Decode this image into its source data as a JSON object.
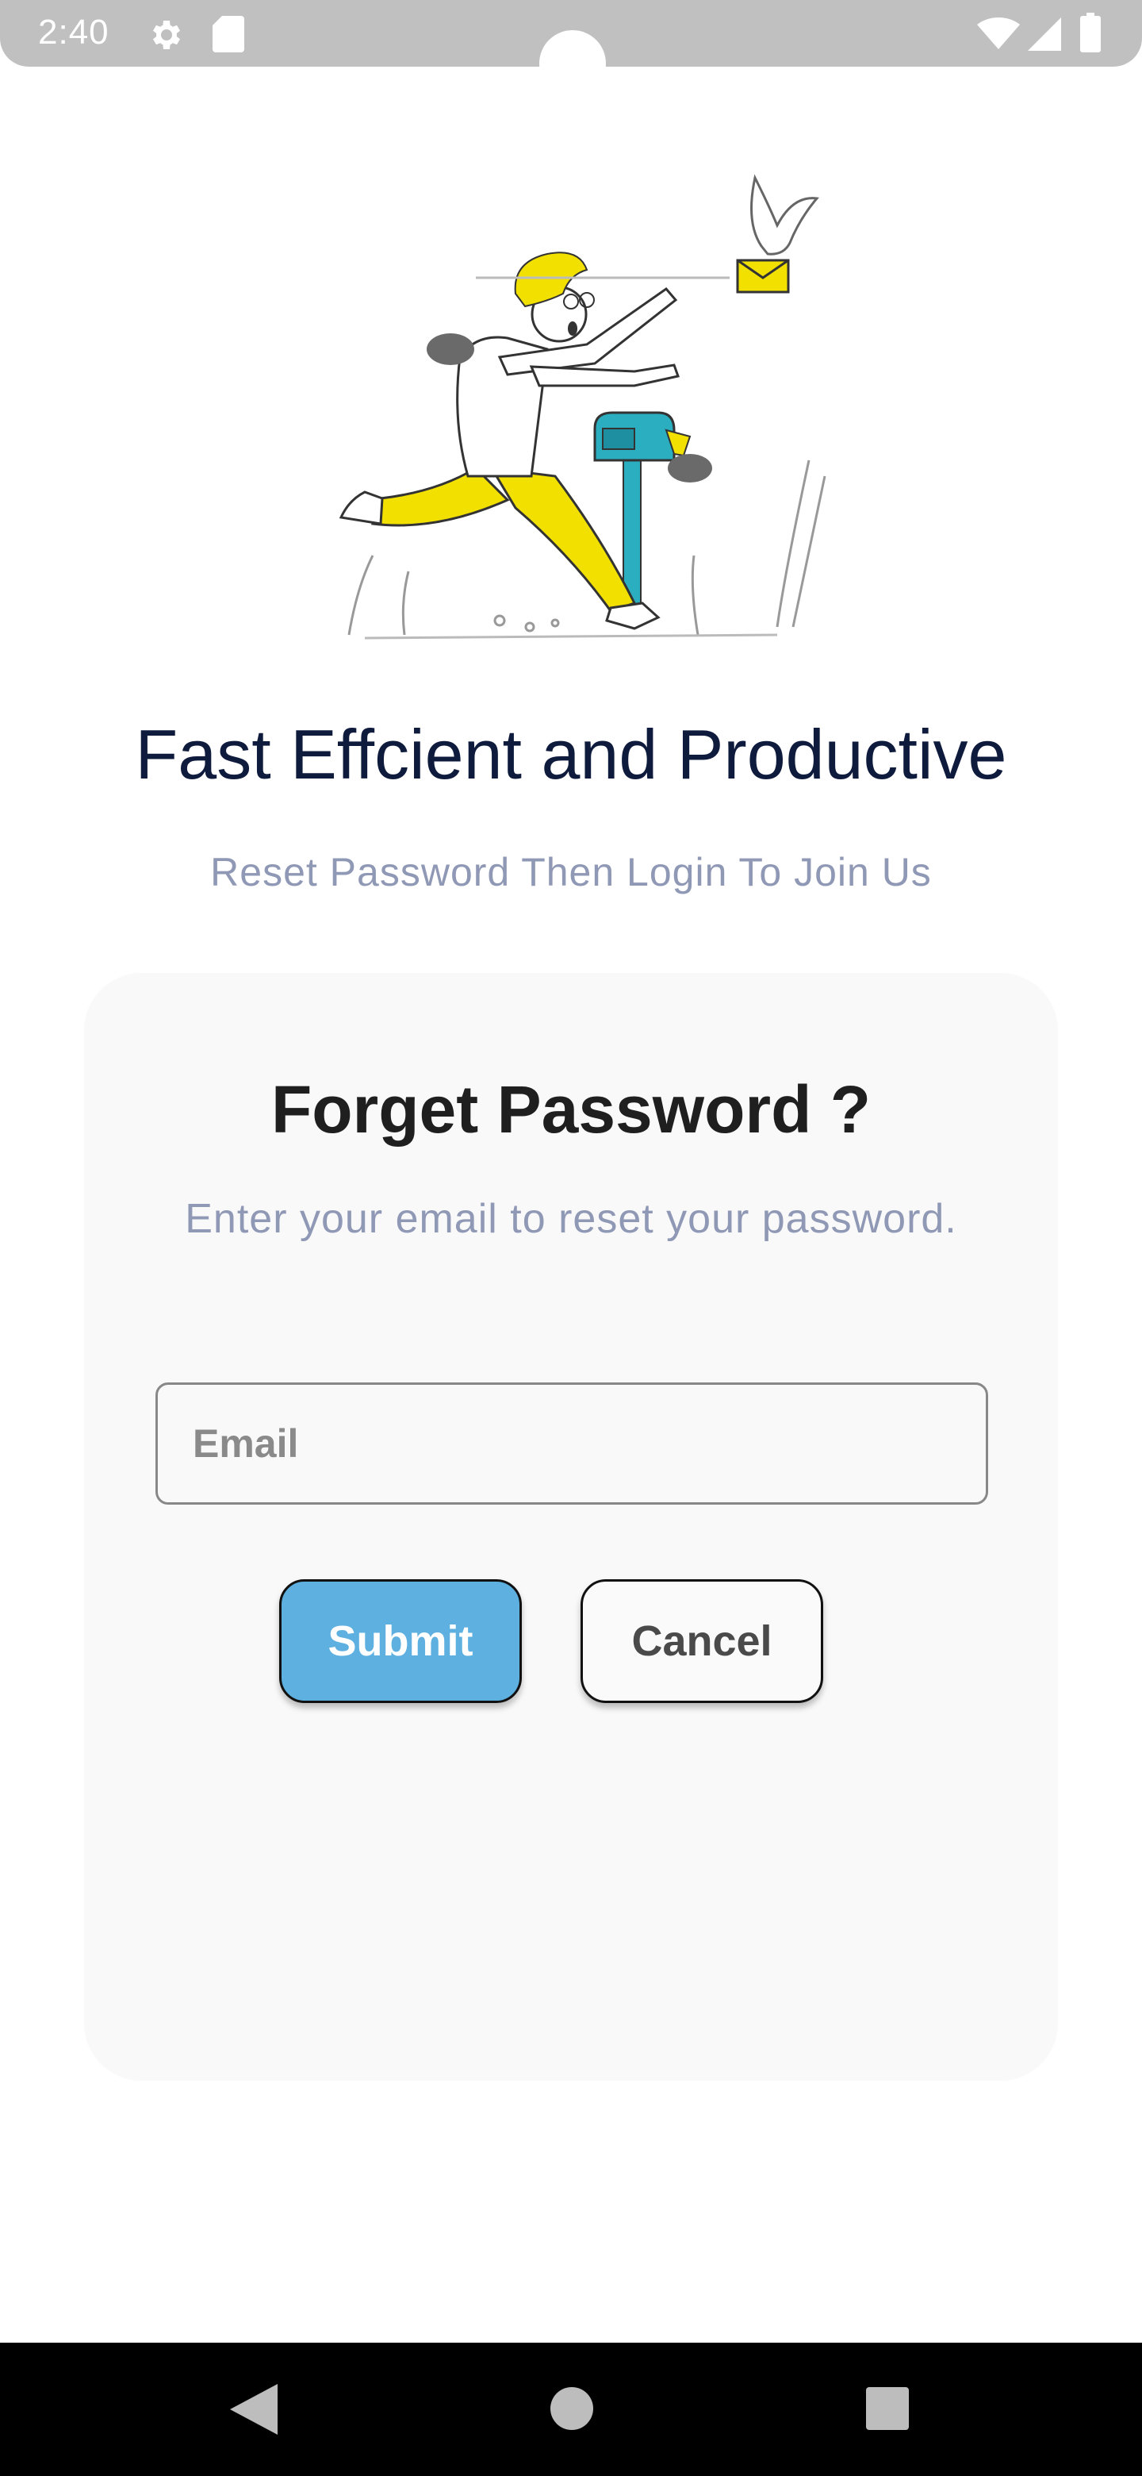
{
  "status_bar": {
    "time": "2:40",
    "icons": [
      "gear-icon",
      "sd-card-icon",
      "wifi-icon",
      "signal-icon",
      "battery-icon"
    ]
  },
  "hero": {
    "illustration": "running-man-mailbox-illustration",
    "colors": {
      "yellow": "#f2e100",
      "teal": "#2aaec0",
      "gray": "#6a6a6a"
    }
  },
  "headline": "Fast Effcient and Productive",
  "subheadline": "Reset Password Then Login To Join Us",
  "card": {
    "title": "Forget Password ?",
    "description": "Enter your email to reset your password.",
    "email": {
      "placeholder": "Email",
      "value": ""
    },
    "submit_label": "Submit",
    "cancel_label": "Cancel"
  },
  "nav_bar": {
    "icons": [
      "back-icon",
      "home-icon",
      "recents-icon"
    ]
  },
  "colors": {
    "status_bar": "#c0c0c0",
    "headline": "#0f1b3d",
    "muted_text": "#8f98b5",
    "card_bg": "#f9f9f9",
    "submit_bg": "#5eb0e0",
    "nav_bar": "#000000"
  }
}
